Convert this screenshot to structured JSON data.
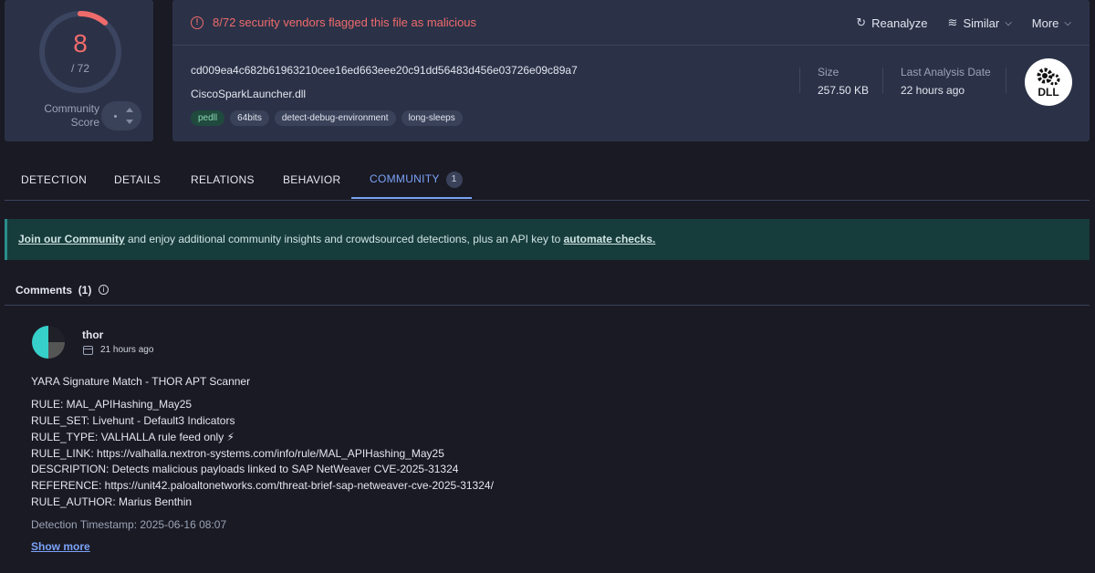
{
  "score": {
    "detections": "8",
    "total_label": "/ 72",
    "detection_ratio": 0.111,
    "community_label_line1": "Community",
    "community_label_line2": "Score",
    "community_value": "-"
  },
  "header": {
    "alert_text": "8/72 security vendors flagged this file as malicious",
    "actions": [
      {
        "label": "Reanalyze",
        "icon": "refresh-icon"
      },
      {
        "label": "Similar",
        "icon": "similar-icon"
      },
      {
        "label": "More",
        "icon": "chevron-down-icon"
      }
    ],
    "hash": "cd009ea4c682b61963210cee16ed663eee20c91dd56483d456e03726e09c89a7",
    "filename": "CiscoSparkLauncher.dll",
    "tags": [
      "pedll",
      "64bits",
      "detect-debug-environment",
      "long-sleeps"
    ],
    "size_label": "Size",
    "size_value": "257.50 KB",
    "last_analysis_label": "Last Analysis Date",
    "last_analysis_value": "22 hours ago",
    "file_type": "DLL"
  },
  "tabs": [
    {
      "label": "DETECTION"
    },
    {
      "label": "DETAILS"
    },
    {
      "label": "RELATIONS"
    },
    {
      "label": "BEHAVIOR"
    },
    {
      "label": "COMMUNITY",
      "badge": "1"
    }
  ],
  "banner": {
    "link1": "Join our Community",
    "middle": " and enjoy additional community insights and crowdsourced detections, plus an API key to ",
    "link2": "automate checks."
  },
  "comments": {
    "title": "Comments",
    "count": "(1)",
    "items": [
      {
        "author": "thor",
        "time": "21 hours ago",
        "heading": "YARA Signature Match - THOR APT Scanner",
        "lines": [
          "RULE: MAL_APIHashing_May25",
          "RULE_SET: Livehunt - Default3 Indicators",
          "RULE_TYPE: VALHALLA rule feed only ⚡",
          "RULE_LINK: https://valhalla.nextron-systems.com/info/rule/MAL_APIHashing_May25",
          "DESCRIPTION: Detects malicious payloads linked to SAP NetWeaver CVE-2025-31324",
          "REFERENCE: https://unit42.paloaltonetworks.com/threat-brief-sap-netweaver-cve-2025-31324/",
          "RULE_AUTHOR: Marius Benthin"
        ],
        "timestamp": "Detection Timestamp: 2025-06-16 08:07",
        "show_more": "Show more"
      }
    ]
  },
  "colors": {
    "background": "#1a1a24",
    "card": "#2b3248",
    "alert_red": "#ef6b6b",
    "accent_blue": "#7aa2f7",
    "banner_teal": "#173c3c"
  }
}
